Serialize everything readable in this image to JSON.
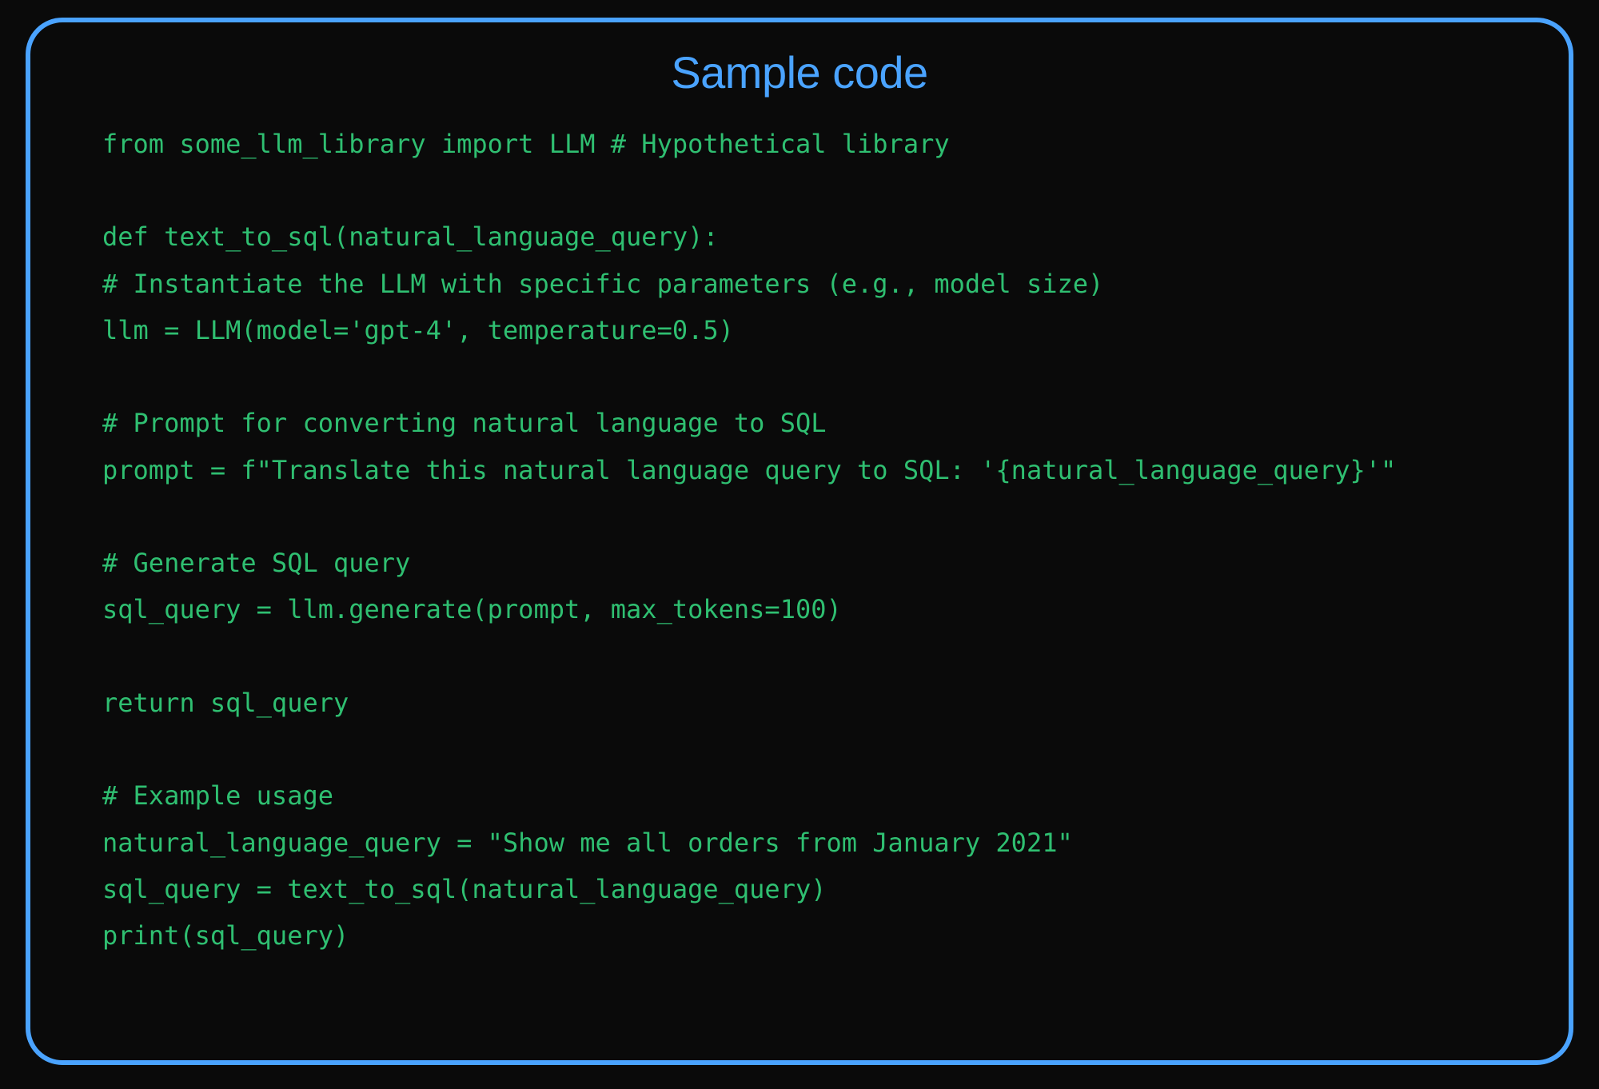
{
  "title": "Sample code",
  "code_lines": [
    "from some_llm_library import LLM # Hypothetical library",
    "",
    "def text_to_sql(natural_language_query):",
    "# Instantiate the LLM with specific parameters (e.g., model size)",
    "llm = LLM(model='gpt-4', temperature=0.5)",
    "",
    "# Prompt for converting natural language to SQL",
    "prompt = f\"Translate this natural language query to SQL: '{natural_language_query}'\"",
    "",
    "# Generate SQL query",
    "sql_query = llm.generate(prompt, max_tokens=100)",
    "",
    "return sql_query",
    "",
    "# Example usage",
    "natural_language_query = \"Show me all orders from January 2021\"",
    "sql_query = text_to_sql(natural_language_query)",
    "print(sql_query)"
  ],
  "colors": {
    "border": "#4aa3ff",
    "title": "#4aa3ff",
    "code": "#2fbf71",
    "background": "#0a0a0a"
  }
}
